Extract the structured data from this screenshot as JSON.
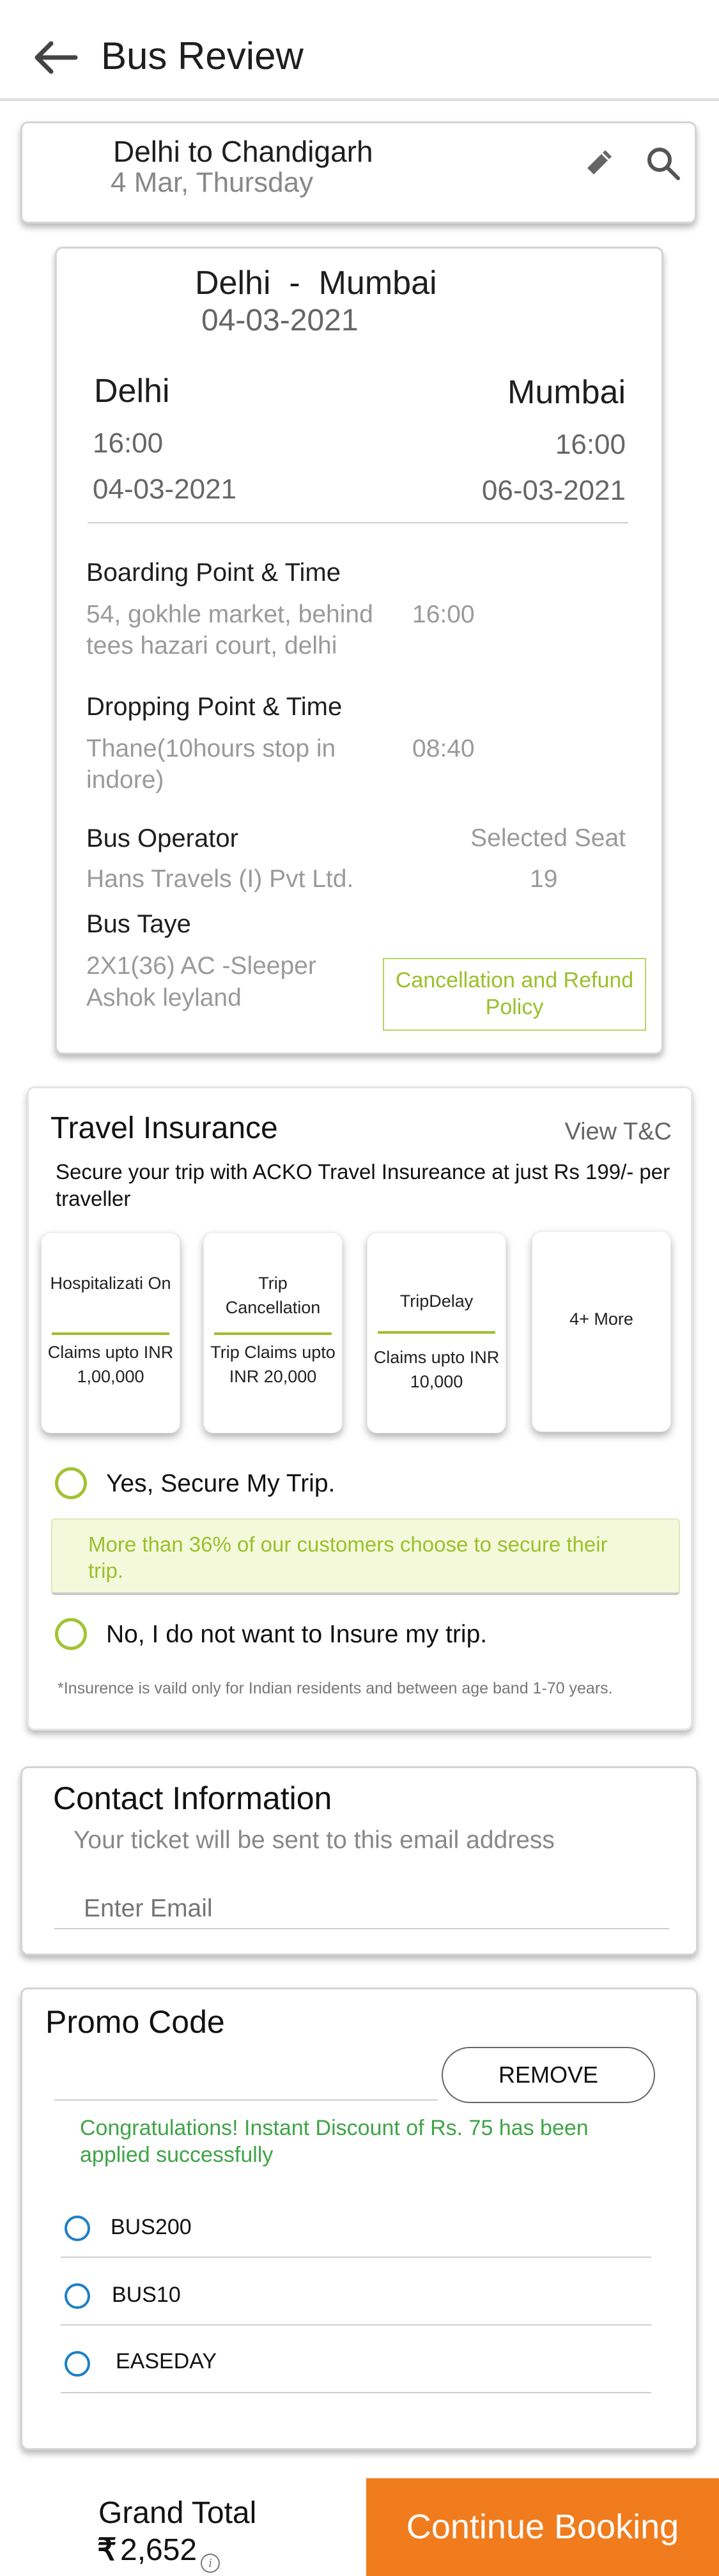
{
  "header": {
    "title": "Bus Review"
  },
  "search": {
    "route": "Delhi to Chandigarh",
    "date": "4 Mar, Thursday"
  },
  "trip": {
    "route_title": "Delhi  -  Mumbai",
    "route_date": "04-03-2021",
    "from_city": "Delhi",
    "to_city": "Mumbai",
    "dep_time": "16:00",
    "arr_time": "16:00",
    "dep_date": "04-03-2021",
    "arr_date": "06-03-2021",
    "boarding_label": "Boarding Point & Time",
    "boarding_address": "54, gokhle market, behind tees hazari court, delhi",
    "boarding_time": "16:00",
    "dropping_label": "Dropping Point & Time",
    "dropping_address": "Thane(10hours stop in indore)",
    "dropping_time": "08:40",
    "operator_label": "Bus Operator",
    "operator_value": "Hans Travels (I) Pvt Ltd.",
    "seat_label": "Selected Seat",
    "seat_value": "19",
    "bustype_label": "Bus Taye",
    "bustype_line1": "2X1(36) AC -Sleeper",
    "bustype_line2": "Ashok leyland",
    "policy_button": "Cancellation and Refund Policy"
  },
  "insurance": {
    "title": "Travel Insurance",
    "tnc_link": "View T&C",
    "desc": "Secure your trip with ACKO Travel Insureance at just Rs 199/- per traveller",
    "tiles": [
      {
        "name": "Hospitalizati On",
        "claim": "Claims upto INR 1,00,000"
      },
      {
        "name": "Trip Cancellation",
        "claim": "Trip Claims upto INR 20,000"
      },
      {
        "name": "TripDelay",
        "claim": "Claims upto INR 10,000"
      },
      {
        "name": "4+ More"
      }
    ],
    "yes_option": "Yes, Secure My Trip.",
    "stat_note": "More than 36% of our customers choose to secure their trip.",
    "no_option": "No, I do not want to Insure my trip.",
    "footnote": "*Insurence is vaild only for Indian residents and between age band 1-70 years."
  },
  "contact": {
    "title": "Contact Information",
    "subtitle": "Your ticket will be sent to this email address",
    "email_placeholder": "Enter Email"
  },
  "promo": {
    "title": "Promo Code",
    "remove_button": "REMOVE",
    "success_msg": "Congratulations! Instant Discount of Rs. 75 has been applied successfully",
    "codes": [
      "BUS200",
      "BUS10",
      "EASEDAY"
    ]
  },
  "footer": {
    "total_label": "Grand Total",
    "currency": "₹",
    "total_value": "2,652",
    "info_icon": "i",
    "cta": "Continue Booking"
  },
  "colors": {
    "accent": "#f07c1e",
    "green": "#9cbf2a",
    "blue": "#1e7fc8",
    "success": "#3fa447"
  }
}
